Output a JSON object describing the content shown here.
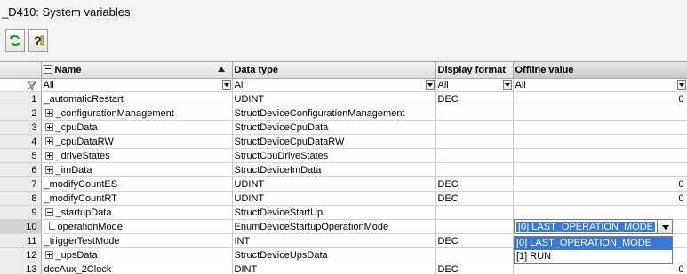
{
  "window": {
    "title": "_D410: System variables"
  },
  "toolbar": {
    "refresh_icon": "refresh-icon",
    "help_icon": "help-icon"
  },
  "columns": {
    "name": "Name",
    "datatype": "Data type",
    "display": "Display format",
    "offline": "Offline value"
  },
  "filter": {
    "name": "All",
    "datatype": "All",
    "display": "All",
    "offline": "All"
  },
  "rows": [
    {
      "n": "1",
      "name": "_automaticRestart",
      "type": "UDINT",
      "fmt": "DEC",
      "val": "0"
    },
    {
      "n": "2",
      "name": "_configurationManagement",
      "type": "StructDeviceConfigurationManagement",
      "fmt": "",
      "val": ""
    },
    {
      "n": "3",
      "name": "_cpuData",
      "type": "StructDeviceCpuData",
      "fmt": "",
      "val": ""
    },
    {
      "n": "4",
      "name": "_cpuDataRW",
      "type": "StructDeviceCpuDataRW",
      "fmt": "",
      "val": ""
    },
    {
      "n": "5",
      "name": "_driveStates",
      "type": "StructCpuDriveStates",
      "fmt": "",
      "val": ""
    },
    {
      "n": "6",
      "name": "_imData",
      "type": "StructDeviceImData",
      "fmt": "",
      "val": ""
    },
    {
      "n": "7",
      "name": "_modifyCountES",
      "type": "UDINT",
      "fmt": "DEC",
      "val": "0"
    },
    {
      "n": "8",
      "name": "_modifyCountRT",
      "type": "UDINT",
      "fmt": "DEC",
      "val": "0"
    },
    {
      "n": "9",
      "name": "_startupData",
      "type": "StructDeviceStartUp",
      "fmt": "",
      "val": ""
    },
    {
      "n": "10",
      "name": "operationMode",
      "type": "EnumDeviceStartupOperationMode",
      "fmt": "",
      "val": ""
    },
    {
      "n": "11",
      "name": "_triggerTestMode",
      "type": "INT",
      "fmt": "DEC",
      "val": ""
    },
    {
      "n": "12",
      "name": "_upsData",
      "type": "StructDeviceUpsData",
      "fmt": "",
      "val": ""
    },
    {
      "n": "13",
      "name": "dccAux_2Clock",
      "type": "DINT",
      "fmt": "DEC",
      "val": "0"
    }
  ],
  "editor": {
    "selected": "[0] LAST_OPERATION_MODE",
    "options": [
      "[0] LAST_OPERATION_MODE",
      "[1] RUN"
    ]
  }
}
